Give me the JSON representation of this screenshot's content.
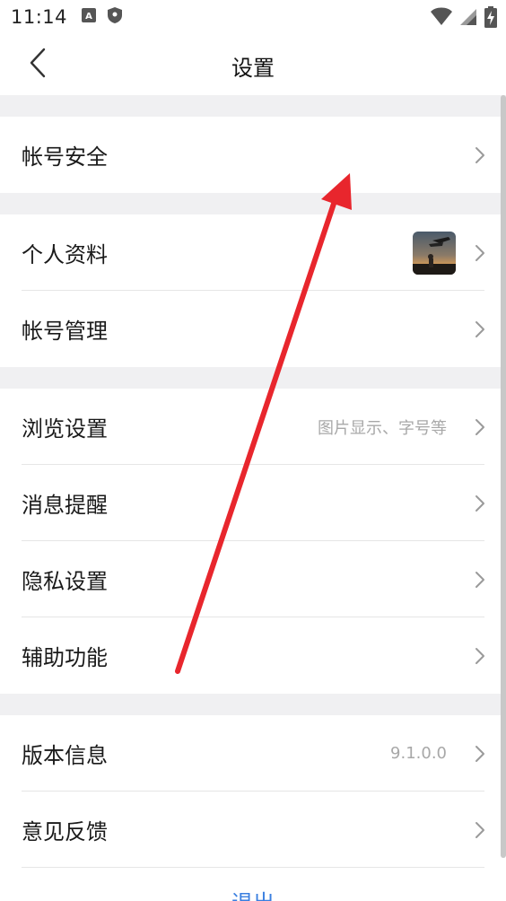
{
  "status_bar": {
    "time": "11:14",
    "icons": [
      "font-icon",
      "shield-icon",
      "wifi-icon",
      "signal-icon",
      "battery-charging-icon"
    ]
  },
  "header": {
    "title": "设置",
    "back_icon": "chevron-left-icon"
  },
  "sections": [
    {
      "items": [
        {
          "label": "帐号安全",
          "value": ""
        }
      ]
    },
    {
      "items": [
        {
          "label": "个人资料",
          "value": "",
          "has_avatar": true
        },
        {
          "label": "帐号管理",
          "value": ""
        }
      ]
    },
    {
      "items": [
        {
          "label": "浏览设置",
          "value": "图片显示、字号等"
        },
        {
          "label": "消息提醒",
          "value": ""
        },
        {
          "label": "隐私设置",
          "value": ""
        },
        {
          "label": "辅助功能",
          "value": ""
        }
      ]
    },
    {
      "items": [
        {
          "label": "版本信息",
          "value": "9.1.0.0"
        },
        {
          "label": "意见反馈",
          "value": ""
        }
      ]
    }
  ],
  "logout_label": "退出",
  "colors": {
    "section_gap": "#f0f0f2",
    "secondary_text": "#a8a8a8",
    "logout_blue": "#3a7fe0",
    "annotation_red": "#e8262d"
  }
}
